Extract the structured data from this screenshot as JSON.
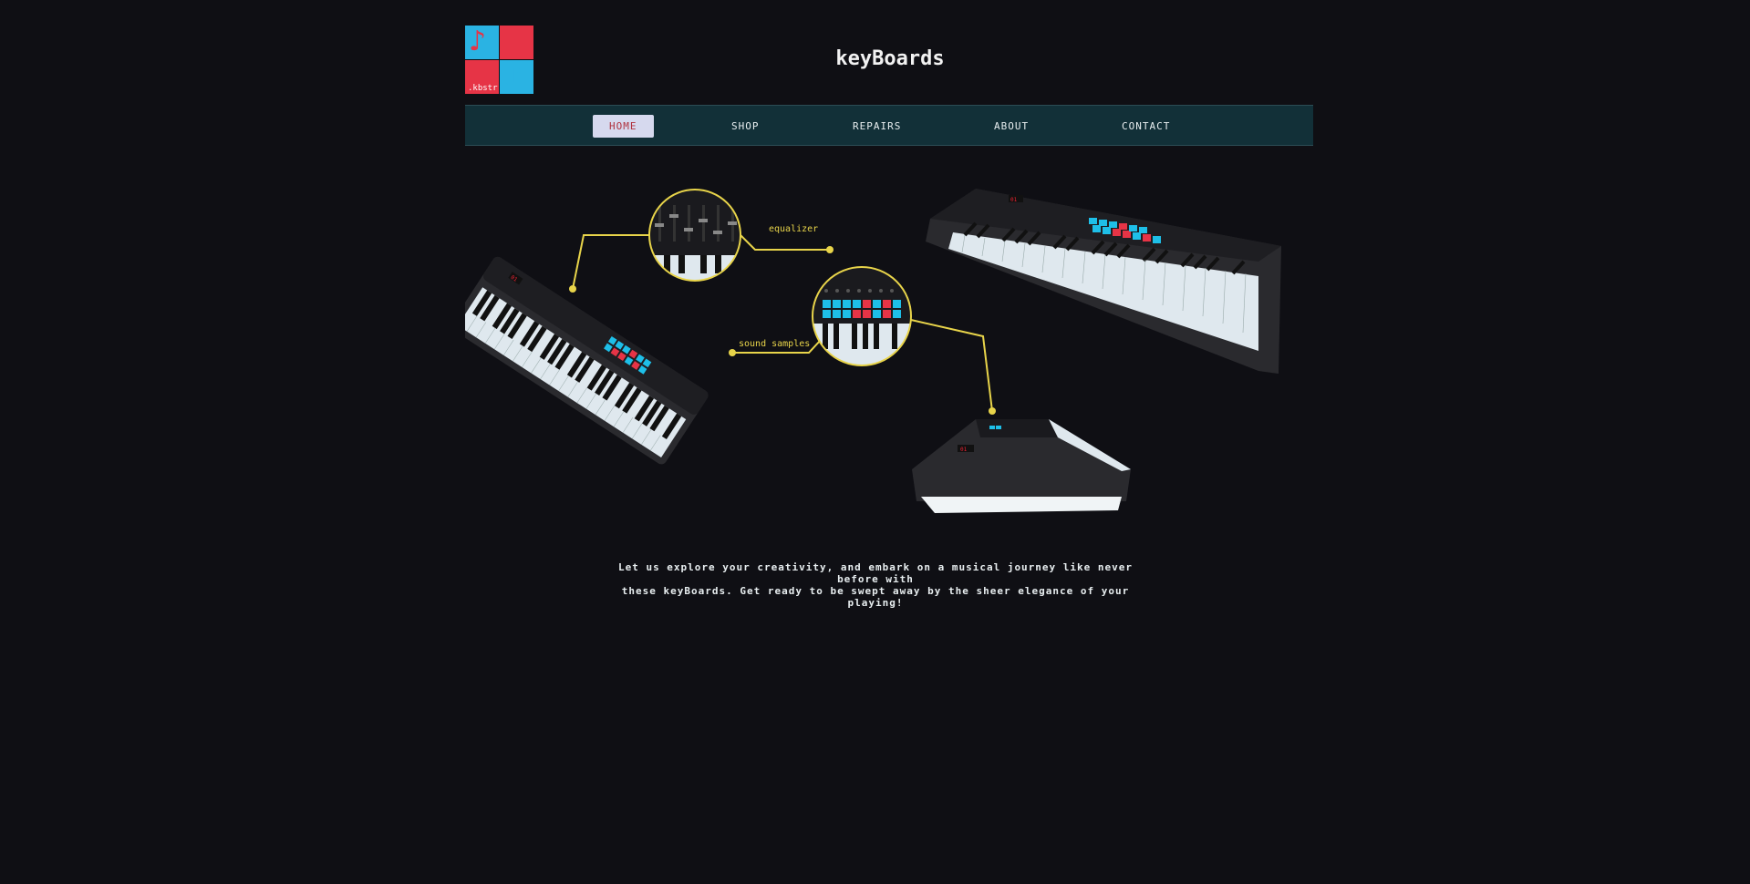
{
  "logo": {
    "tagline": ".kbstr",
    "icon": "music-note-icon"
  },
  "header": {
    "title": "keyBoards"
  },
  "nav": {
    "items": [
      {
        "label": "HOME",
        "active": true
      },
      {
        "label": "SHOP",
        "active": false
      },
      {
        "label": "REPAIRS",
        "active": false
      },
      {
        "label": "ABOUT",
        "active": false
      },
      {
        "label": "CONTACT",
        "active": false
      }
    ]
  },
  "hero": {
    "callouts": [
      {
        "label": "equalizer"
      },
      {
        "label": "sound samples"
      }
    ]
  },
  "tagline": {
    "line1": "Let us explore your creativity, and embark on a musical journey like never before with",
    "line2": "these keyBoards. Get ready to be swept away by the sheer elegance of your playing!"
  },
  "colors": {
    "background": "#0f0f14",
    "navbar": "#123038",
    "accent_yellow": "#e8d44a",
    "pad_blue": "#1ebfe8",
    "pad_red": "#e63446"
  }
}
